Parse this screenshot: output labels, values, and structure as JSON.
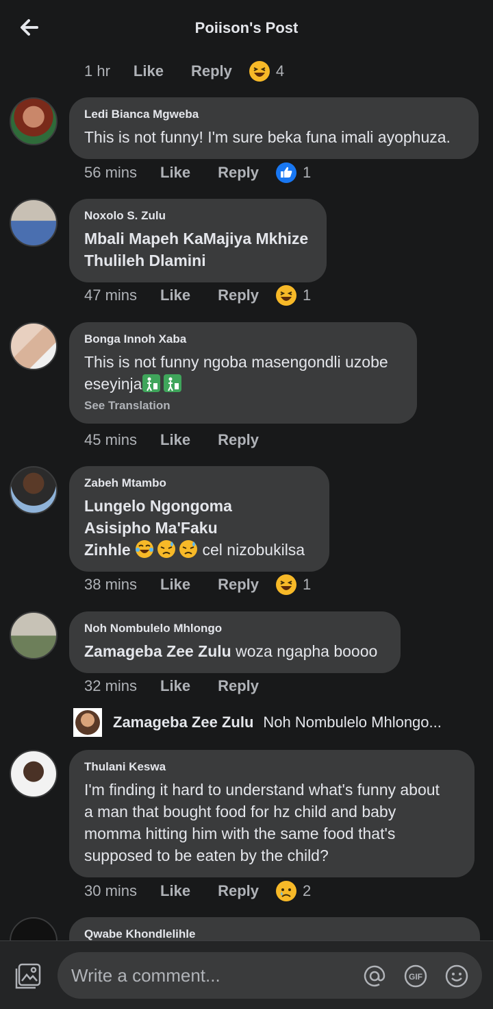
{
  "header": {
    "title": "Poiison's Post",
    "back_icon": "arrow-left-icon"
  },
  "top_meta": {
    "time": "1 hr",
    "like": "Like",
    "reply": "Reply",
    "reaction": "haha-emoji",
    "count": "4"
  },
  "comments": [
    {
      "name": "Ledi Bianca Mgweba",
      "text": "This is not funny! I'm sure beka funa imali ayophuza.",
      "time": "56 mins",
      "like": "Like",
      "reply": "Reply",
      "reaction": "like-emoji",
      "count": "1"
    },
    {
      "name": "Noxolo S. Zulu",
      "line1": "Mbali Mapeh KaMajiya Mkhize",
      "line2": "Thulileh Dlamini",
      "time": "47 mins",
      "like": "Like",
      "reply": "Reply",
      "reaction": "haha-emoji",
      "count": "1"
    },
    {
      "name": "Bonga Innoh Xaba",
      "line1": "This is not funny ngoba masengondli uzobe",
      "line2": "eseyinja",
      "see_translation": "See Translation",
      "time": "45 mins",
      "like": "Like",
      "reply": "Reply"
    },
    {
      "name": "Zabeh Mtambo",
      "line1": "Lungelo Ngongoma",
      "line2": "Asisipho Ma'Faku",
      "line3_tag": "Zinhle",
      "line3_rest": " cel nizobukilsa",
      "time": "38 mins",
      "like": "Like",
      "reply": "Reply",
      "reaction": "haha-emoji",
      "count": "1"
    },
    {
      "name": "Noh Nombulelo Mhlongo",
      "tag": "Zamageba Zee Zulu",
      "rest": " woza ngapha boooo",
      "time": "32 mins",
      "like": "Like",
      "reply": "Reply"
    },
    {
      "name": "Thulani Keswa",
      "lines": [
        "I'm finding it hard to understand what's funny about",
        "a man that bought food for hz child and baby",
        "momma hitting him with the same food that's",
        "supposed to be eaten by the child?"
      ],
      "time": "30 mins",
      "like": "Like",
      "reply": "Reply",
      "reaction": "sad-emoji",
      "count": "2"
    },
    {
      "name": "Qwabe Khondlelihle"
    }
  ],
  "reply_preview": {
    "name": "Zamageba Zee Zulu",
    "text": "Noh Nombulelo Mhlongo..."
  },
  "composer": {
    "placeholder": "Write a comment...",
    "icons": [
      "photo-icon",
      "mention-icon",
      "gif-icon",
      "emoji-icon"
    ]
  },
  "colors": {
    "background": "#18191a",
    "bubble": "#3a3b3c",
    "text": "#e4e6eb",
    "secondary": "#b0b3b8",
    "like_blue": "#1877f2",
    "emoji_yellow": "#f7b928"
  }
}
